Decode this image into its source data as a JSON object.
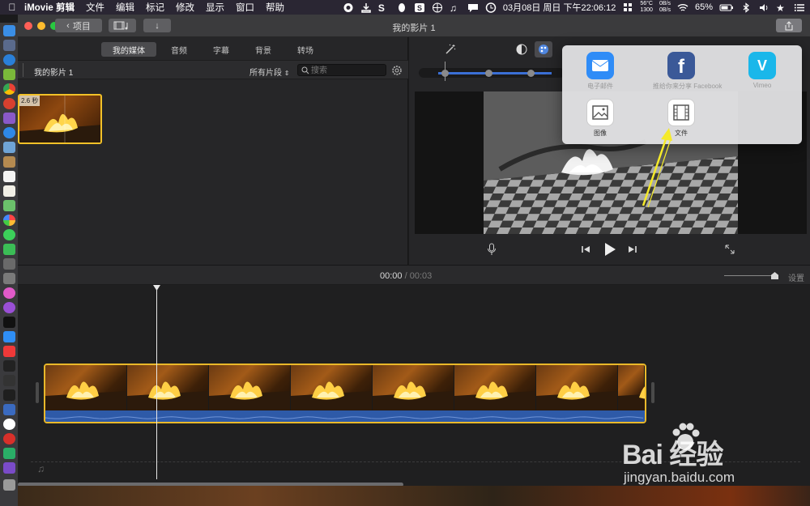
{
  "menubar": {
    "app_name": "iMovie 剪辑",
    "items": [
      "文件",
      "编辑",
      "标记",
      "修改",
      "显示",
      "窗口",
      "帮助"
    ],
    "status": {
      "datetime": "03月08日 周日 下午22:06:12",
      "temp": "56°C",
      "rpm": "1300",
      "net_up": "0B/s",
      "net_down": "0B/s",
      "battery": "65%"
    }
  },
  "window": {
    "title": "我的影片 1",
    "back_label": "项目"
  },
  "browser": {
    "tabs": [
      "我的媒体",
      "音频",
      "字幕",
      "背景",
      "转场"
    ],
    "active_tab": "我的媒体",
    "library_title": "我的影片 1",
    "filter_label": "所有片段",
    "search_placeholder": "搜索",
    "clip_duration": "2.6 秒"
  },
  "share_menu": {
    "items": [
      {
        "label": "电子邮件",
        "icon": "mail-icon",
        "color": "#2f8cf7",
        "enabled": false
      },
      {
        "label": "推给你来分享 Facebook",
        "icon": "facebook-icon",
        "color": "#3b5998",
        "enabled": false
      },
      {
        "label": "Vimeo",
        "icon": "vimeo-icon",
        "color": "#1ab7ea",
        "enabled": false
      },
      {
        "label": "图像",
        "icon": "image-icon",
        "color": "#ffffff",
        "enabled": true
      },
      {
        "label": "文件",
        "icon": "film-icon",
        "color": "#ffffff",
        "enabled": true
      }
    ]
  },
  "timeline": {
    "current_time": "00:00",
    "separator": "/",
    "total_time": "00:03",
    "settings_label": "设置",
    "frame_count": 8
  },
  "watermark": {
    "brand": "Bai 经验",
    "url": "jingyan.baidu.com"
  },
  "colors": {
    "accent_blue": "#3b6fd6",
    "clip_border": "#e9b82a",
    "annotation_arrow": "#f5ea2a"
  }
}
